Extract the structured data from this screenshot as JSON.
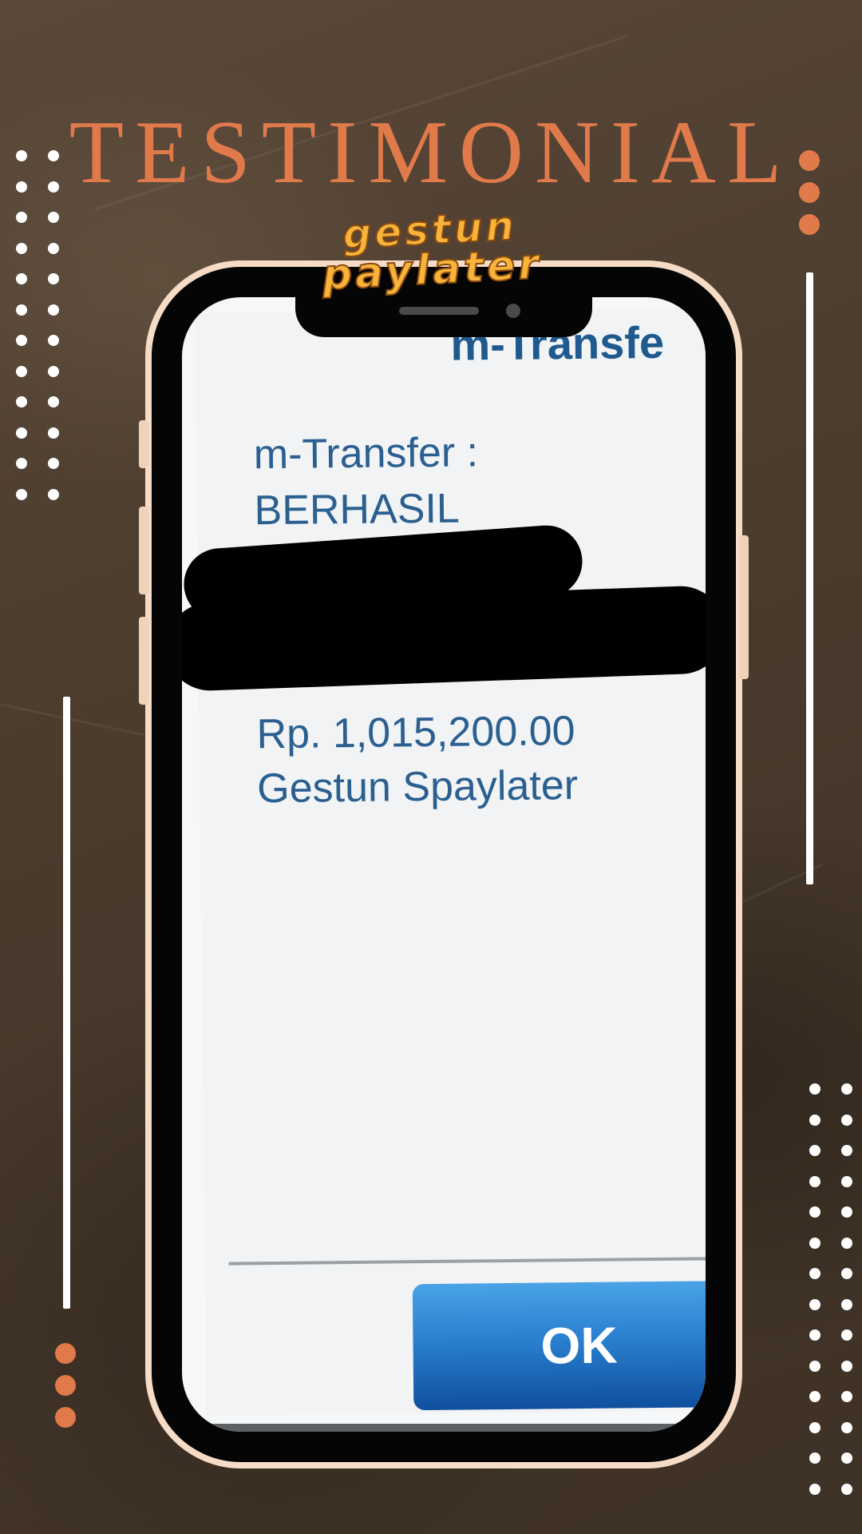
{
  "title": "TESTIMONIAL",
  "logo": {
    "line1": "gestun",
    "line2": "paylater"
  },
  "receipt": {
    "header_partial": "m-Transfe",
    "status_label": "m-Transfer :",
    "status_value": "BERHASIL",
    "amount": "Rp. 1,015,200.00",
    "description": "Gestun Spaylater",
    "ok_label": "OK"
  },
  "colors": {
    "title": "#e07a4a",
    "accent_dots": "#e07a4a",
    "decor_white": "#ffffff",
    "receipt_text": "#2a5f90",
    "ok_button": "#1f6fc0",
    "logo_fill": "#f7b33a",
    "phone_frame": "#f6dcc6"
  }
}
